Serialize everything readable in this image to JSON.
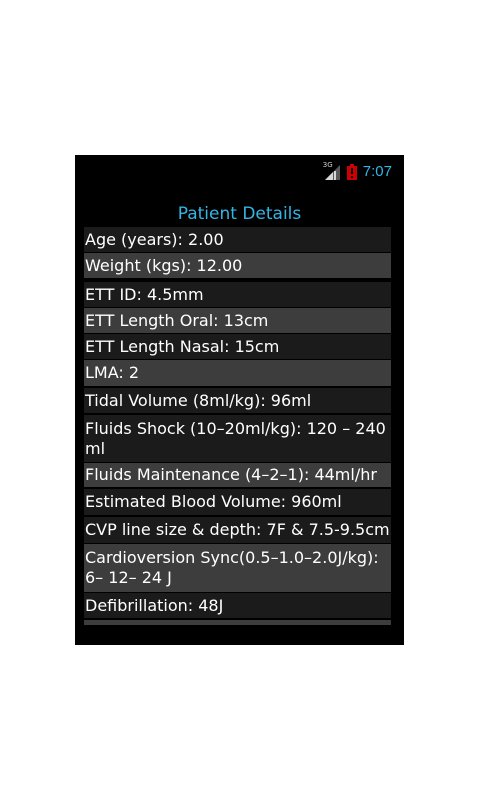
{
  "status_bar": {
    "network_type": "3G",
    "signal_icon": "cell-signal-icon",
    "battery_icon": "battery-alert-icon",
    "time": "7:07"
  },
  "screen": {
    "title": "Patient Details"
  },
  "details": [
    {
      "lines": [
        "Age (years): 2.00"
      ],
      "shade": "dark"
    },
    {
      "lines": [
        "Weight (kgs): 12.00"
      ],
      "shade": "light"
    },
    {
      "lines": [
        "ETT ID: 4.5mm"
      ],
      "shade": "dark"
    },
    {
      "lines": [
        "ETT Length Oral: 13cm"
      ],
      "shade": "light"
    },
    {
      "lines": [
        "ETT Length Nasal: 15cm"
      ],
      "shade": "dark"
    },
    {
      "lines": [
        "LMA: 2"
      ],
      "shade": "light"
    },
    {
      "lines": [
        "Tidal Volume (8ml/kg): 96ml"
      ],
      "shade": "dark"
    },
    {
      "lines": [
        "Fluids Shock (10–20ml/kg): 120 – 240",
        "ml"
      ],
      "shade": "dark"
    },
    {
      "lines": [
        "Fluids Maintenance (4–2–1): 44ml/hr"
      ],
      "shade": "light"
    },
    {
      "lines": [
        "Estimated Blood Volume: 960ml"
      ],
      "shade": "dark"
    },
    {
      "lines": [
        "CVP line size & depth: 7F & 7.5-9.5cm"
      ],
      "shade": "dark"
    },
    {
      "lines": [
        "Cardioversion Sync(0.5–1.0–2.0J/kg):",
        "6– 12– 24 J"
      ],
      "shade": "light"
    },
    {
      "lines": [
        "Defibrillation: 48J"
      ],
      "shade": "dark"
    },
    {
      "lines": [
        ""
      ],
      "shade": "light"
    }
  ]
}
